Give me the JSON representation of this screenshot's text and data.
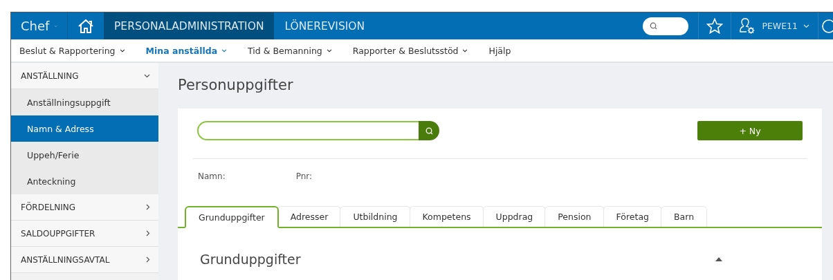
{
  "topbar": {
    "role": "Chef",
    "modules": [
      {
        "label": "PERSONALADMINISTRATION",
        "selected": true
      },
      {
        "label": "LÖNEREVISION",
        "selected": false
      }
    ],
    "user": "PEWE11"
  },
  "menu": [
    {
      "label": "Beslut & Rapportering",
      "selected": false,
      "dropdown": true
    },
    {
      "label": "Mina anställda",
      "selected": true,
      "dropdown": true
    },
    {
      "label": "Tid & Bemanning",
      "selected": false,
      "dropdown": true
    },
    {
      "label": "Rapporter & Beslutsstöd",
      "selected": false,
      "dropdown": true
    },
    {
      "label": "Hjälp",
      "selected": false,
      "dropdown": false
    }
  ],
  "sidebar": {
    "items": [
      {
        "label": "ANSTÄLLNING",
        "expanded": true,
        "children": [
          {
            "label": "Anställningsuppgift",
            "selected": false
          },
          {
            "label": "Namn & Adress",
            "selected": true
          },
          {
            "label": "Uppeh/Ferie",
            "selected": false
          },
          {
            "label": "Anteckning",
            "selected": false
          }
        ]
      },
      {
        "label": "FÖRDELNING",
        "expanded": false
      },
      {
        "label": "SALDOUPPGIFTER",
        "expanded": false
      },
      {
        "label": "ANSTÄLLNINGSAVTAL",
        "expanded": false
      }
    ]
  },
  "page_title": "Personuppgifter",
  "new_button": "+ Ny",
  "person": {
    "name_label": "Namn:",
    "pnr_label": "Pnr:"
  },
  "tabs": [
    {
      "label": "Grunduppgifter",
      "selected": true
    },
    {
      "label": "Adresser",
      "selected": false
    },
    {
      "label": "Utbildning",
      "selected": false
    },
    {
      "label": "Kompetens",
      "selected": false
    },
    {
      "label": "Uppdrag",
      "selected": false
    },
    {
      "label": "Pension",
      "selected": false
    },
    {
      "label": "Företag",
      "selected": false
    },
    {
      "label": "Barn",
      "selected": false
    }
  ],
  "section": {
    "title": "Grunduppgifter",
    "expanded": true
  }
}
